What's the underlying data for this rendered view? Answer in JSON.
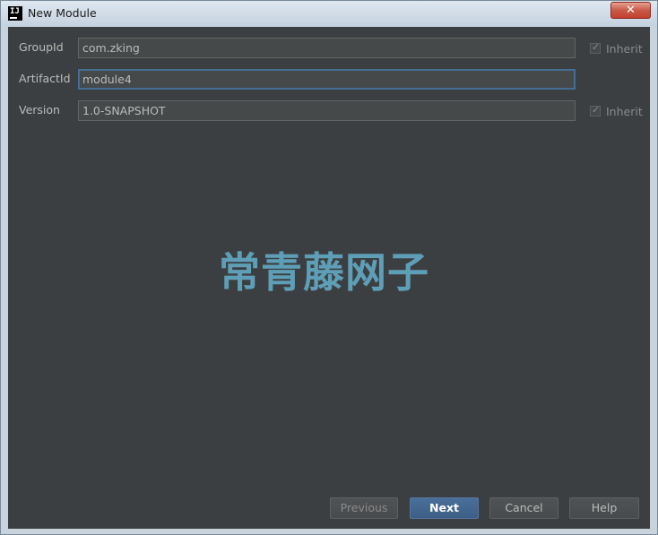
{
  "window": {
    "title": "New Module",
    "close_label": "✕",
    "app_icon_text": "IJ"
  },
  "form": {
    "group_id": {
      "label": "GroupId",
      "value": "com.zking",
      "inherit_label": "Inherit",
      "inherit_checked": true
    },
    "artifact_id": {
      "label": "ArtifactId",
      "value": "module4"
    },
    "version": {
      "label": "Version",
      "value": "1.0-SNAPSHOT",
      "inherit_label": "Inherit",
      "inherit_checked": true
    }
  },
  "watermark": "常青藤网子",
  "buttons": {
    "previous": "Previous",
    "next": "Next",
    "cancel": "Cancel",
    "help": "Help"
  },
  "colors": {
    "background": "#3c3f41",
    "accent": "#466d94",
    "watermark": "#5e9fb7"
  }
}
